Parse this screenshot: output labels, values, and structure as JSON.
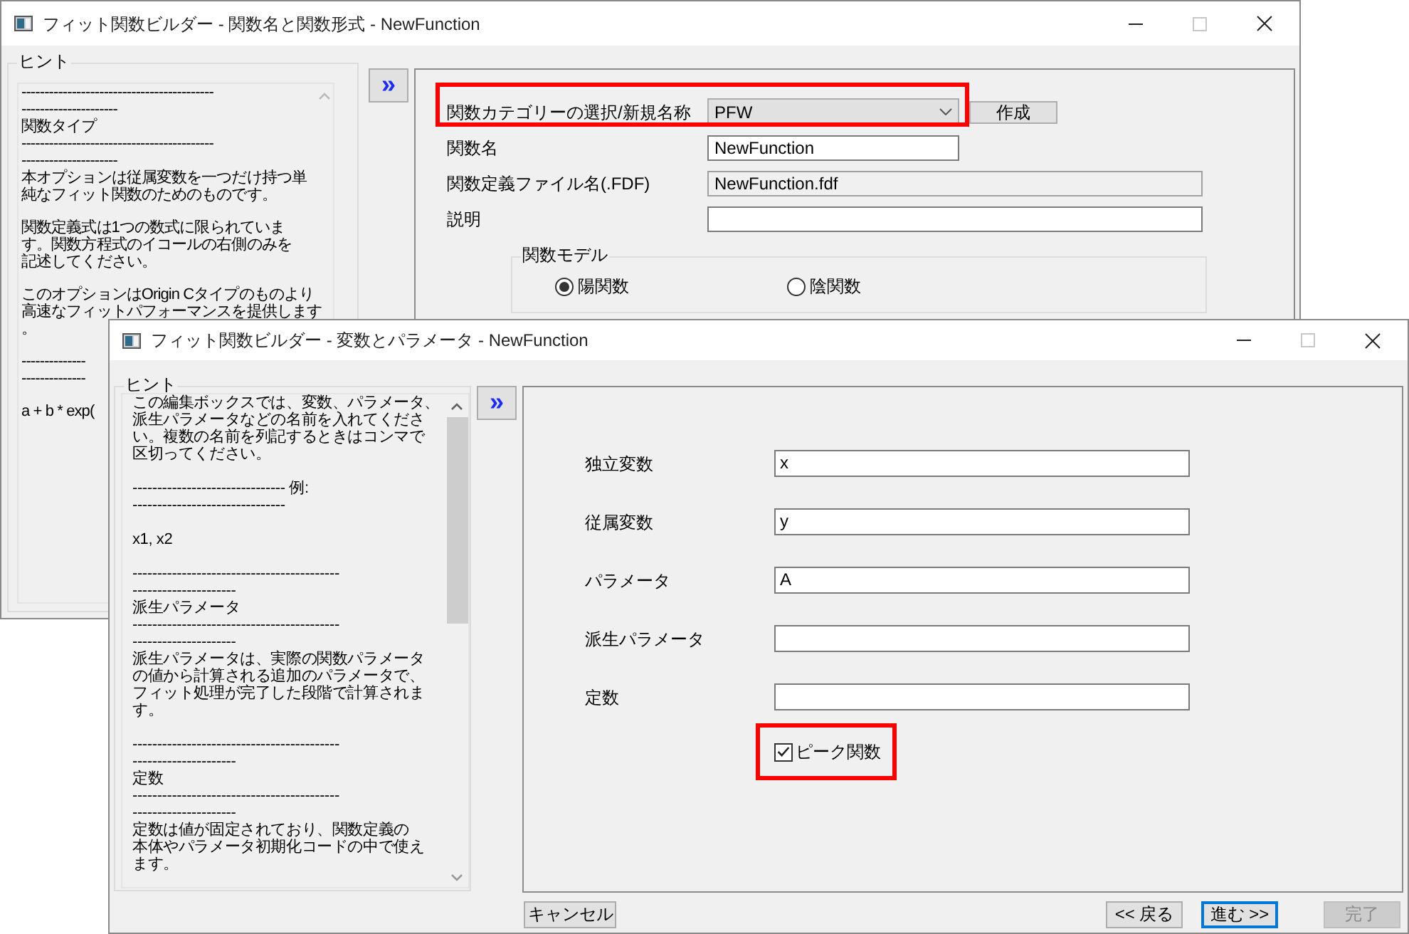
{
  "back_window": {
    "title": "フィット関数ビルダー - 関数名と関数形式 - NewFunction",
    "hint": {
      "label": "ヒント",
      "blocks": [
        {
          "lines": [
            "------------------------------------------",
            "---------------------",
            "関数タイプ",
            "------------------------------------------",
            "---------------------",
            "本オプションは従属変数を一つだけ持つ単",
            "純なフィット関数のためのものです。"
          ]
        },
        {
          "lines": [
            "関数定義式は1つの数式に限られていま",
            "す。関数方程式のイコールの右側のみを",
            "記述してください。"
          ]
        },
        {
          "lines": [
            "このオプションはOrigin Cタイプのものより",
            "高速なフィットパフォーマンスを提供します",
            "。"
          ]
        },
        {
          "lines": [
            "--------------",
            "--------------"
          ]
        },
        {
          "lines": [
            "a + b * exp("
          ]
        }
      ]
    },
    "expand_button": "»",
    "form": {
      "rows": [
        {
          "kind": "combo",
          "label": "関数カテゴリーの選択/新規名称",
          "value": "PFW",
          "highlighted": true
        },
        {
          "kind": "text",
          "label": "関数名",
          "value": "NewFunction",
          "highlighted": false
        },
        {
          "kind": "readonly",
          "label": "関数定義ファイル名(.FDF)",
          "value": "NewFunction.fdf",
          "highlighted": false
        },
        {
          "kind": "text",
          "label": "説明",
          "highlighted": false
        }
      ],
      "create_button": "作成",
      "model_group": {
        "label": "関数モデル",
        "options": [
          {
            "label": "陽関数",
            "selected": true
          },
          {
            "label": "陰関数",
            "selected": false
          }
        ]
      }
    }
  },
  "front_window": {
    "title": "フィット関数ビルダー - 変数とパラメータ - NewFunction",
    "hint": {
      "label": "ヒント",
      "blocks": [
        {
          "lines": [
            "この編集ボックスでは、変数、パラメータ、",
            "派生パラメータなどの名前を入れてくださ",
            "い。複数の名前を列記するときはコンマで",
            "区切ってください。"
          ]
        },
        {
          "lines": [
            "------------------------------- 例:",
            "-------------------------------"
          ]
        },
        {
          "lines": [
            "x1, x2"
          ]
        },
        {
          "lines": [
            "------------------------------------------",
            "---------------------",
            "派生パラメータ",
            "------------------------------------------",
            "---------------------",
            "派生パラメータは、実際の関数パラメータ",
            "の値から計算される追加のパラメータで、",
            "フィット処理が完了した段階で計算されま",
            "す。"
          ]
        },
        {
          "lines": [
            "------------------------------------------",
            "---------------------",
            "定数",
            "------------------------------------------",
            "---------------------",
            "定数は値が固定されており、関数定義の",
            "本体やパラメータ初期化コードの中で使え",
            "ます。"
          ]
        }
      ]
    },
    "expand_button": "»",
    "fields": [
      {
        "label": "独立変数",
        "value": "x"
      },
      {
        "label": "従属変数",
        "value": "y"
      },
      {
        "label": "パラメータ",
        "value": "A"
      },
      {
        "label": "派生パラメータ"
      },
      {
        "label": "定数"
      }
    ],
    "peak_checkbox": {
      "label": "ピーク関数",
      "checked": true,
      "highlighted": true
    },
    "buttons": [
      {
        "kind": "cancel",
        "label": "キャンセル",
        "default": false,
        "disabled": false
      },
      {
        "kind": "nav",
        "label": "<< 戻る",
        "default": false,
        "disabled": false
      },
      {
        "kind": "nav",
        "label": "進む >>",
        "default": true,
        "disabled": false
      },
      {
        "kind": "nav",
        "label": "完了",
        "default": false,
        "disabled": true
      }
    ]
  }
}
